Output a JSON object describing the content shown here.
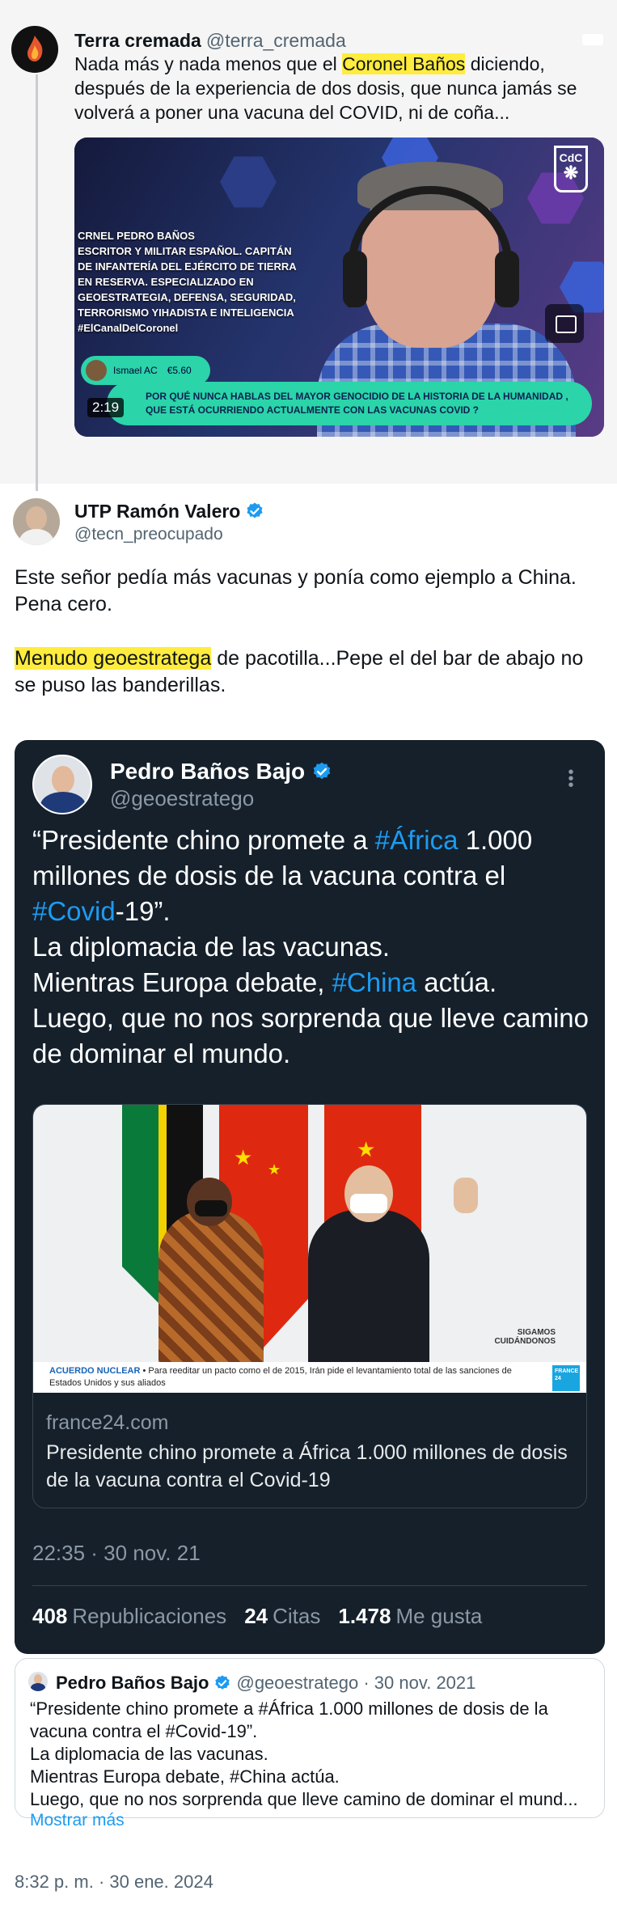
{
  "reply": {
    "name": "Terra cremada",
    "handle": "@terra_cremada",
    "text_before": "Nada más y nada menos que el ",
    "text_highlight": "Coronel Baños",
    "text_after": " diciendo, después de la experiencia de dos dosis,  que nunca jamás se volverá a poner una vacuna del COVID, ni de coña...",
    "video": {
      "caption": "CRNEL PEDRO BAÑOS\nESCRITOR Y MILITAR ESPAÑOL. CAPITÁN\nDE INFANTERÍA DEL EJÉRCITO DE TIERRA\n EN RESERVA. ESPECIALIZADO EN\nGEOESTRATEGIA, DEFENSA, SEGURIDAD,\nTERRORISMO YIHADISTA E INTELIGENCIA\n#ElCanalDelCoronel",
      "logo": "CdC",
      "donor_name": "Ismael AC",
      "donor_amount": "€5.60",
      "question": "POR QUÉ NUNCA HABLAS DEL MAYOR GENOCIDIO DE LA HISTORIA DE LA HUMANIDAD , QUE ESTÁ OCURRIENDO ACTUALMENTE CON LAS VACUNAS COVID ?",
      "duration": "2:19"
    }
  },
  "main": {
    "name": "UTP Ramón Valero",
    "handle": "@tecn_preocupado",
    "paragraph1": "Este señor pedía más vacunas y ponía como ejemplo a China. Pena cero.",
    "para2_highlight": "Menudo geoestratega",
    "para2_rest": " de pacotilla...Pepe el del bar de abajo no se puso las banderillas."
  },
  "embedded": {
    "name": "Pedro Baños Bajo",
    "handle": "@geoestratego",
    "line1_a": "“Presidente chino promete a ",
    "line1_tag": "#África",
    "line1_b": " 1.000 millones de dosis de la vacuna contra el ",
    "line1_tag2": "#Covid",
    "line1_c": "-19”.",
    "line2": "La diplomacia de las vacunas.",
    "line3_a": "Mientras Europa debate, ",
    "line3_tag": "#China",
    "line3_b": " actúa.",
    "line4": "Luego, que no nos sorprenda que lleve camino de dominar el mundo.",
    "photo": {
      "sigamos": "SIGAMOS",
      "cuidandonos": "CUIDÁNDONOS",
      "ticker_tag": "ACUERDO NUCLEAR",
      "ticker_text": " • Para reeditar un pacto como el de 2015, Irán pide el levantamiento total de las sanciones de Estados Unidos y sus aliados",
      "channel": "FRANCE 24"
    },
    "card_domain": "france24.com",
    "card_title": "Presidente chino promete a África 1.000 millones de dosis de la vacuna contra el Covid-19",
    "time": "22:35 · 30 nov. 21",
    "stats": {
      "reposts_num": "408",
      "reposts_label": "Republicaciones",
      "quotes_num": "24",
      "quotes_label": "Citas",
      "likes_num": "1.478",
      "likes_label": "Me gusta"
    }
  },
  "quote": {
    "name": "Pedro Baños Bajo",
    "handle_date": "@geoestratego · 30 nov. 2021",
    "lines": [
      "“Presidente chino promete a #África 1.000 millones de dosis de la",
      "vacuna contra el #Covid-19”.",
      "La diplomacia de las vacunas.",
      "Mientras Europa debate, #China actúa.",
      "Luego, que no nos sorprenda que lleve camino de dominar el mund..."
    ],
    "show_more": "Mostrar más"
  },
  "footer": {
    "timestamp": "8:32 p. m. · 30 ene. 2024"
  },
  "colors": {
    "accent": "#1d9bf0",
    "highlight": "#ffec3d",
    "dark_bg": "#15202b"
  }
}
